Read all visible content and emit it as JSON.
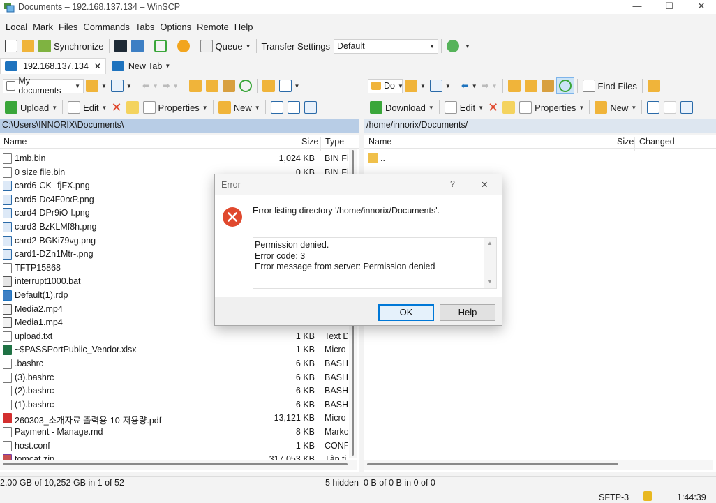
{
  "window": {
    "title": "Documents – 192.168.137.134 – WinSCP",
    "minimize_glyph": "—",
    "maximize_glyph": "☐",
    "close_glyph": "✕"
  },
  "menu": [
    "Local",
    "Mark",
    "Files",
    "Commands",
    "Tabs",
    "Options",
    "Remote",
    "Help"
  ],
  "toolbar_main": {
    "synchronize": "Synchronize",
    "queue": "Queue",
    "transfer_settings_label": "Transfer Settings",
    "transfer_settings_value": "Default"
  },
  "tabs": {
    "session_tab": "192.168.137.134",
    "session_tab_close": "✕",
    "new_tab": "New Tab"
  },
  "local": {
    "location_combo": "My documents",
    "upload": "Upload",
    "edit": "Edit",
    "properties": "Properties",
    "new": "New",
    "path": "C:\\Users\\INNORIX\\Documents\\",
    "col_name": "Name",
    "col_size": "Size",
    "col_type": "Type",
    "files": [
      {
        "name": "1mb.bin",
        "size": "1,024 KB",
        "type": "BIN Fi"
      },
      {
        "name": "0 size file.bin",
        "size": "0 KB",
        "type": "BIN Fi"
      },
      {
        "name": "card6-CK--fjFX.png",
        "size": "",
        "type": ""
      },
      {
        "name": "card5-Dc4F0rxP.png",
        "size": "",
        "type": ""
      },
      {
        "name": "card4-DPr9iO-l.png",
        "size": "",
        "type": ""
      },
      {
        "name": "card3-BzKLMf8h.png",
        "size": "",
        "type": ""
      },
      {
        "name": "card2-BGKi79vg.png",
        "size": "",
        "type": ""
      },
      {
        "name": "card1-DZn1Mtr-.png",
        "size": "",
        "type": ""
      },
      {
        "name": "TFTP15868",
        "size": "",
        "type": ""
      },
      {
        "name": "interrupt1000.bat",
        "size": "",
        "type": ""
      },
      {
        "name": "Default(1).rdp",
        "size": "",
        "type": ""
      },
      {
        "name": "Media2.mp4",
        "size": "",
        "type": ""
      },
      {
        "name": "Media1.mp4",
        "size": "",
        "type": ""
      },
      {
        "name": "upload.txt",
        "size": "1 KB",
        "type": "Text D"
      },
      {
        "name": "~$PASSPortPublic_Vendor.xlsx",
        "size": "1 KB",
        "type": "Micro"
      },
      {
        "name": ".bashrc",
        "size": "6 KB",
        "type": "BASH"
      },
      {
        "name": "(3).bashrc",
        "size": "6 KB",
        "type": "BASH"
      },
      {
        "name": "(2).bashrc",
        "size": "6 KB",
        "type": "BASH"
      },
      {
        "name": "(1).bashrc",
        "size": "6 KB",
        "type": "BASH"
      },
      {
        "name": "260303_소개자료 출력용-10-저용량.pdf",
        "size": "13,121 KB",
        "type": "Micro"
      },
      {
        "name": "Payment - Manage.md",
        "size": "8 KB",
        "type": "Marko"
      },
      {
        "name": "host.conf",
        "size": "1 KB",
        "type": "CONF"
      },
      {
        "name": "tomcat.zip",
        "size": "317,053 KB",
        "type": "Tập ti"
      }
    ]
  },
  "remote": {
    "location_combo": "Do",
    "find_files": "Find Files",
    "download": "Download",
    "edit": "Edit",
    "properties": "Properties",
    "new": "New",
    "path": "/home/innorix/Documents/",
    "col_name": "Name",
    "col_size": "Size",
    "col_changed": "Changed",
    "parent_dir": ".."
  },
  "status": {
    "local_summary": "2.00 GB of 10,252 GB in 1 of 52",
    "hidden": "5 hidden",
    "remote_summary": "0 B of 0 B in 0 of 0",
    "protocol": "SFTP-3",
    "time": "1:44:39"
  },
  "dialog": {
    "title": "Error",
    "help_glyph": "?",
    "close_glyph": "✕",
    "message": "Error listing directory '/home/innorix/Documents'.",
    "details": [
      "Permission denied.",
      "Error code: 3",
      "Error message from server: Permission denied"
    ],
    "ok": "OK",
    "help": "Help"
  },
  "colors": {
    "accent": "#0078d7",
    "error_red": "#e0492e",
    "local_path_bg": "#b8cde6"
  }
}
